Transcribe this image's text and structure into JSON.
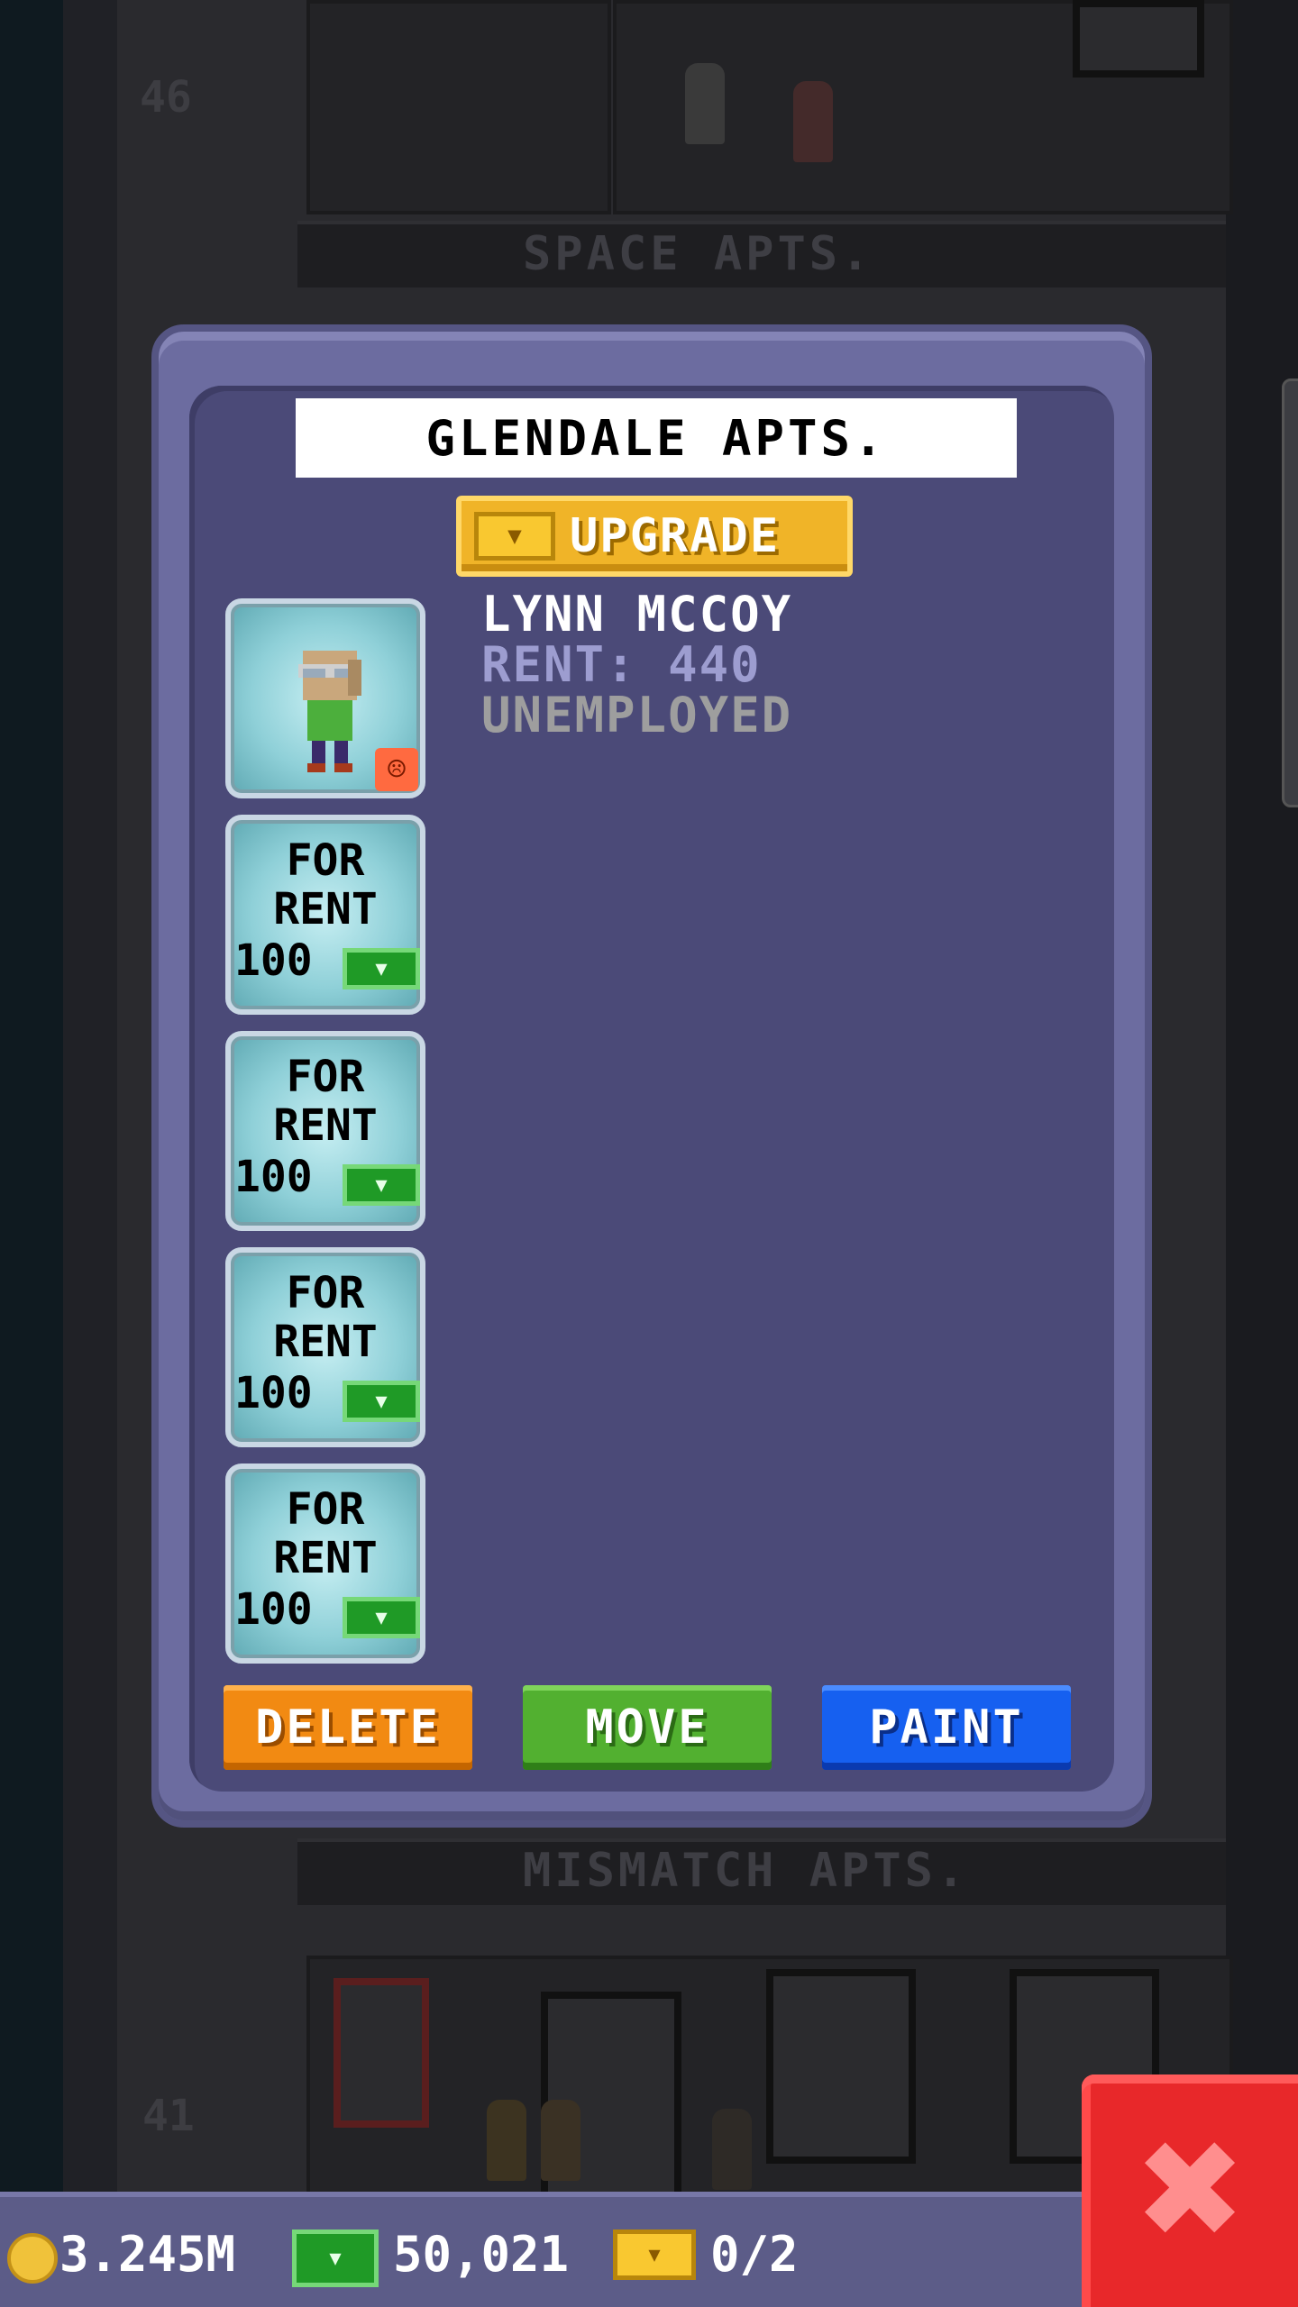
{
  "background": {
    "floor_top_number": "46",
    "floor_top_label": "SPACE APTS.",
    "floor_bottom_label": "MISMATCH APTS.",
    "floor_bottom_number": "41"
  },
  "dialog": {
    "title": "GLENDALE APTS.",
    "upgrade_label": "UPGRADE",
    "tenant": {
      "name": "LYNN MCCOY",
      "rent": "RENT: 440",
      "job": "UNEMPLOYED",
      "mood_icon": "sad-face-icon"
    },
    "slots": [
      {
        "line1": "FOR",
        "line2": "RENT",
        "price": "100"
      },
      {
        "line1": "FOR",
        "line2": "RENT",
        "price": "100"
      },
      {
        "line1": "FOR",
        "line2": "RENT",
        "price": "100"
      },
      {
        "line1": "FOR",
        "line2": "RENT",
        "price": "100"
      }
    ],
    "buttons": {
      "delete": "DELETE",
      "move": "MOVE",
      "paint": "PAINT"
    }
  },
  "status_bar": {
    "coins": "3.245M",
    "cash": "50,021",
    "bux": "0/2"
  },
  "colors": {
    "dialog_bg": "#4b4a78",
    "delete": "#f28a12",
    "move": "#52b030",
    "paint": "#1660f0",
    "close": "#e8282a"
  }
}
